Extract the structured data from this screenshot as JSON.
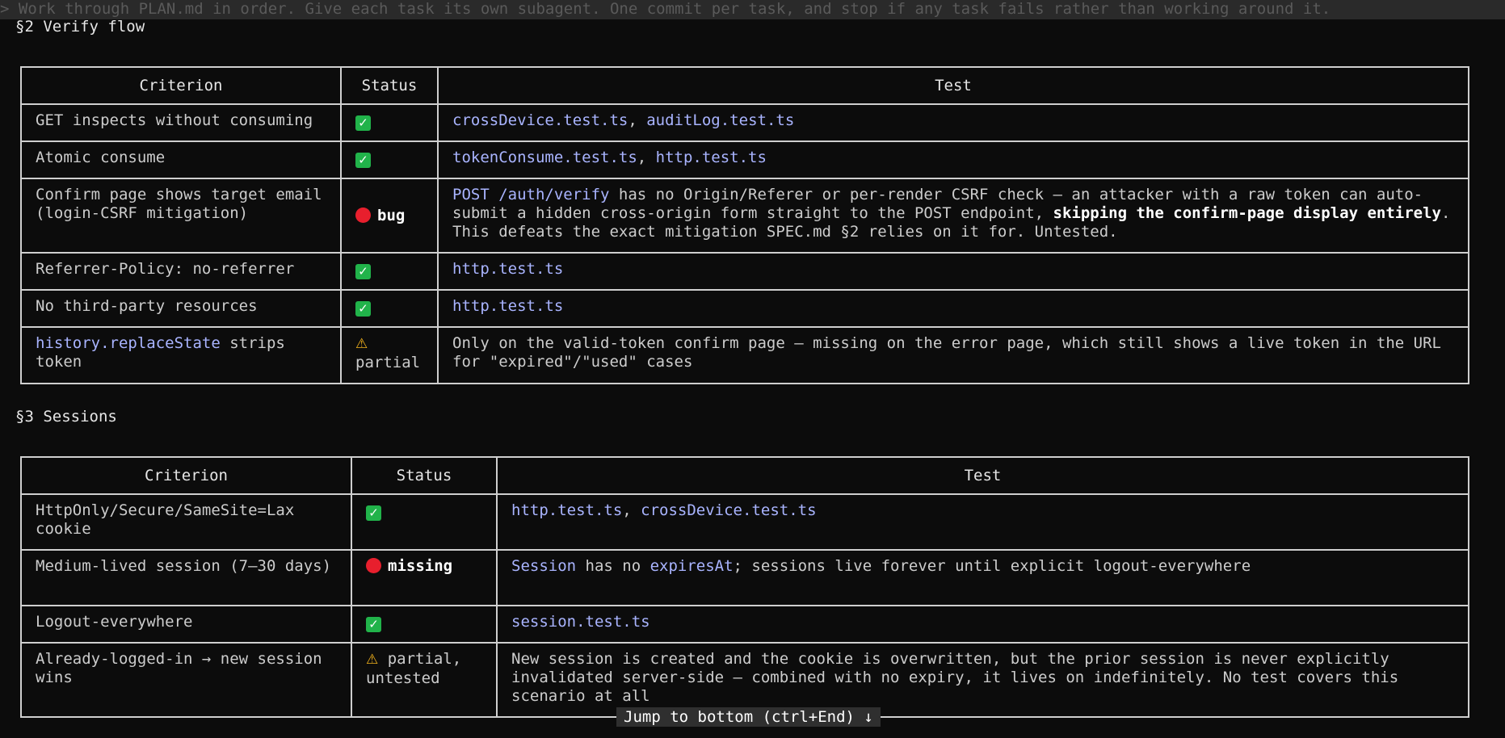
{
  "prompt": "> Work through PLAN.md in order. Give each task its own subagent. One commit per task, and stop if any task fails rather than working around it.",
  "section2": {
    "title": "§2 Verify flow",
    "headers": [
      "Criterion",
      "Status",
      "Test"
    ],
    "rows": [
      {
        "criterion": "GET inspects without consuming",
        "status": "check",
        "test": [
          [
            "crossDevice.test.ts",
            "code"
          ],
          [
            ", ",
            ""
          ],
          [
            "auditLog.test.ts",
            "code"
          ]
        ]
      },
      {
        "criterion": "Atomic consume",
        "status": "check",
        "test": [
          [
            "tokenConsume.test.ts",
            "code"
          ],
          [
            ", ",
            ""
          ],
          [
            "http.test.ts",
            "code"
          ]
        ]
      },
      {
        "criterion": "Confirm page shows target email (login-CSRF mitigation)",
        "status": "bug",
        "status_label": "bug",
        "test": [
          [
            "POST /auth/verify",
            "code"
          ],
          [
            " has no Origin/Referer or per-render CSRF check — an attacker with a raw token can auto-submit a hidden cross-origin form straight to the POST endpoint, ",
            ""
          ],
          [
            "skipping the confirm-page display entirely",
            "bold"
          ],
          [
            ". This defeats the exact mitigation SPEC.md §2 relies on it for. Untested.",
            ""
          ]
        ]
      },
      {
        "criterion": "Referrer-Policy: no-referrer",
        "status": "check",
        "test": [
          [
            "http.test.ts",
            "code"
          ]
        ]
      },
      {
        "criterion": "No third-party resources",
        "status": "check",
        "test": [
          [
            "http.test.ts",
            "code"
          ]
        ]
      },
      {
        "criterion_parts": [
          [
            "history.replaceState",
            "code"
          ],
          [
            " strips token",
            ""
          ]
        ],
        "status": "warn",
        "status_label": "partial",
        "test": [
          [
            "Only on the valid-token confirm page — missing on the error page, which still shows a live token in the URL for \"expired\"/\"used\" cases",
            ""
          ]
        ]
      }
    ]
  },
  "section3": {
    "title": "§3 Sessions",
    "headers": [
      "Criterion",
      "Status",
      "Test"
    ],
    "rows": [
      {
        "criterion": "HttpOnly/Secure/SameSite=Lax cookie",
        "status": "check",
        "test": [
          [
            "http.test.ts",
            "code"
          ],
          [
            ", ",
            ""
          ],
          [
            "crossDevice.test.ts",
            "code"
          ]
        ]
      },
      {
        "criterion": "Medium-lived session (7–30 days)",
        "status": "bug",
        "status_label": "missing",
        "test": [
          [
            "Session",
            "code"
          ],
          [
            " has no ",
            ""
          ],
          [
            "expiresAt",
            "code"
          ],
          [
            "; sessions live forever until explicit logout-everywhere",
            ""
          ]
        ]
      },
      {
        "criterion": "Logout-everywhere",
        "status": "check",
        "test": [
          [
            "session.test.ts",
            "code"
          ]
        ]
      },
      {
        "criterion": "Already-logged-in → new session wins",
        "status": "warn",
        "status_label": "partial, untested",
        "test": [
          [
            "New session is created and the cookie is overwritten, but the prior session is never explicitly invalidated server-side — combined with no expiry, it lives on indefinitely. No test covers this scenario at all",
            ""
          ]
        ]
      }
    ]
  },
  "jump_label": "Jump to bottom (ctrl+End) ↓",
  "icons": {
    "check": "check-icon",
    "bug": "red-circle-icon",
    "warn": "warning-icon"
  },
  "colors": {
    "background": "#0c0c0c",
    "code": "#a9b4ff",
    "check": "#21b34a",
    "bug": "#e81f2d",
    "warn": "#f2b21c"
  }
}
